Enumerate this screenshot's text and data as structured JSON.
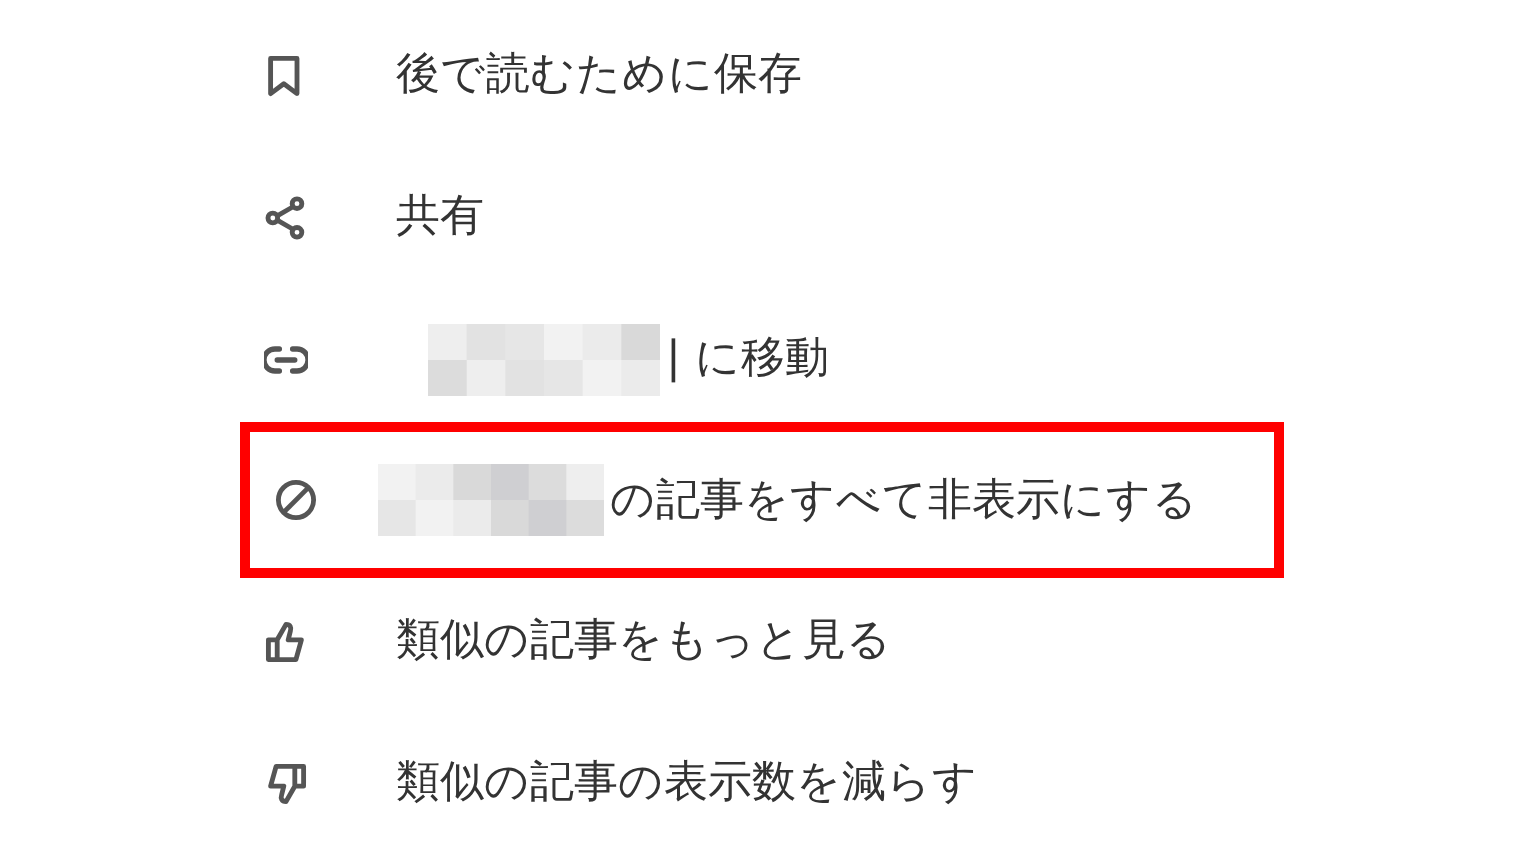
{
  "menu": {
    "items": [
      {
        "label": "後で読むために保存",
        "redacted": false,
        "highlighted": false
      },
      {
        "label": "共有",
        "redacted": false,
        "highlighted": false
      },
      {
        "label": "| に移動",
        "redacted": true,
        "highlighted": false
      },
      {
        "label": "の記事をすべて非表示にする",
        "redacted": true,
        "highlighted": true
      },
      {
        "label": "類似の記事をもっと見る",
        "redacted": false,
        "highlighted": false
      },
      {
        "label": "類似の記事の表示数を減らす",
        "redacted": false,
        "highlighted": false
      }
    ]
  }
}
